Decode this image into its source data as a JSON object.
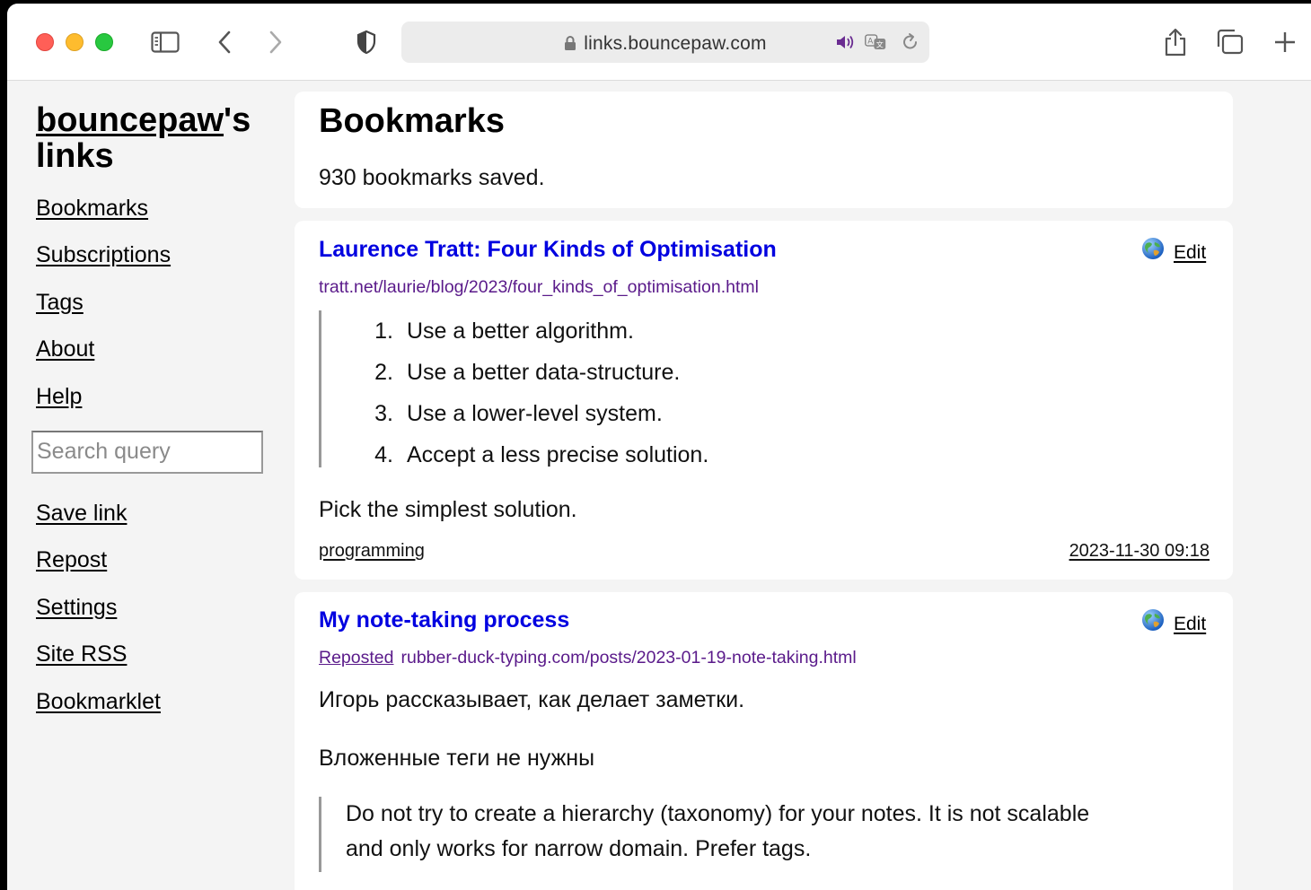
{
  "browser": {
    "address": "links.bouncepaw.com"
  },
  "sidebar": {
    "site_title_owner": "bouncepaw",
    "site_title_rest": "'s links",
    "nav_top": [
      "Bookmarks",
      "Subscriptions",
      "Tags",
      "About",
      "Help"
    ],
    "search_placeholder": "Search query",
    "nav_bottom": [
      "Save link",
      "Repost",
      "Settings",
      "Site RSS",
      "Bookmarklet"
    ]
  },
  "header": {
    "title": "Bookmarks",
    "count_text": "930 bookmarks saved."
  },
  "bookmarks": [
    {
      "title": "Laurence Tratt: Four Kinds of Optimisation",
      "url": "tratt.net/laurie/blog/2023/four_kinds_of_optimisation.html",
      "edit_label": "Edit",
      "quote_items": [
        {
          "num": "1.",
          "text": "Use a better algorithm."
        },
        {
          "num": "2.",
          "text": "Use a better data-structure."
        },
        {
          "num": "3.",
          "text": "Use a lower-level system."
        },
        {
          "num": "4.",
          "text": "Accept a less precise solution."
        }
      ],
      "description": "Pick the simplest solution.",
      "tag": "programming",
      "date": "2023-11-30 09:18"
    },
    {
      "title": "My note-taking process",
      "repost_label": "Reposted",
      "url": "rubber-duck-typing.com/posts/2023-01-19-note-taking.html",
      "edit_label": "Edit",
      "description": "Игорь рассказывает, как делает заметки.",
      "subheading": "Вложенные теги не нужны",
      "quote_text": "Do not try to create a hierarchy (taxonomy) for your notes. It is not scalable and only works for narrow domain. Prefer tags."
    }
  ],
  "icons": {
    "globe": "globe-icon",
    "lock": "lock-icon",
    "audio": "speaker-icon",
    "translate": "translate-icon",
    "reload": "reload-icon"
  }
}
